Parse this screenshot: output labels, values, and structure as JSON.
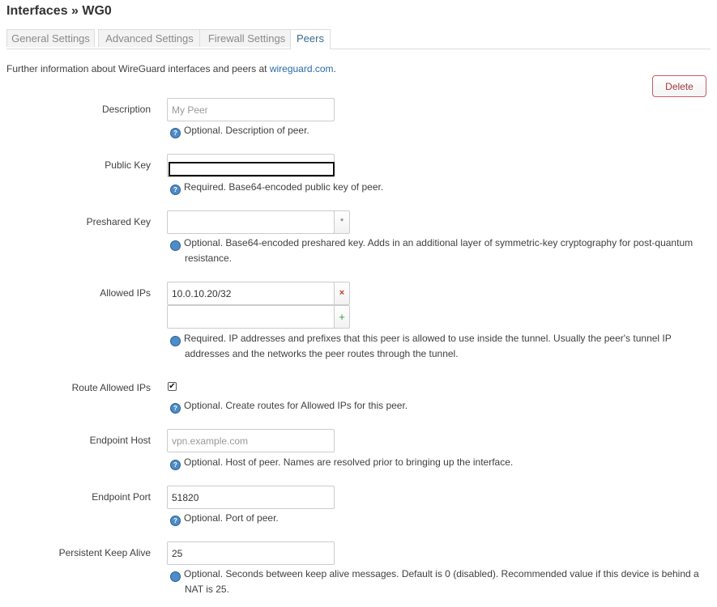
{
  "page_title": "Interfaces » WG0",
  "tabs": [
    {
      "label": "General Settings"
    },
    {
      "label": "Advanced Settings"
    },
    {
      "label": "Firewall Settings"
    },
    {
      "label": "Peers"
    }
  ],
  "intro": {
    "text": "Further information about WireGuard interfaces and peers at ",
    "link": "wireguard.com",
    "suffix": "."
  },
  "delete_label": "Delete",
  "fields": {
    "description": {
      "label": "Description",
      "value": "",
      "placeholder": "My Peer",
      "help": "Optional. Description of peer."
    },
    "public_key": {
      "label": "Public Key",
      "value": "",
      "help": "Required. Base64-encoded public key of peer."
    },
    "preshared_key": {
      "label": "Preshared Key",
      "value": "",
      "button": "*",
      "help": "Optional. Base64-encoded preshared key. Adds in an additional layer of symmetric-key cryptography for post-quantum resistance."
    },
    "allowed_ips": {
      "label": "Allowed IPs",
      "value": "10.0.10.20/32",
      "remove_symbol": "×",
      "new_value": "",
      "add_symbol": "+",
      "help": "Required. IP addresses and prefixes that this peer is allowed to use inside the tunnel. Usually the peer's tunnel IP addresses and the networks the peer routes through the tunnel."
    },
    "route_allowed_ips": {
      "label": "Route Allowed IPs",
      "checked_symbol": "✔",
      "help": "Optional. Create routes for Allowed IPs for this peer."
    },
    "endpoint_host": {
      "label": "Endpoint Host",
      "value": "",
      "placeholder": "vpn.example.com",
      "help": "Optional. Host of peer. Names are resolved prior to bringing up the interface."
    },
    "endpoint_port": {
      "label": "Endpoint Port",
      "value": "51820",
      "help": "Optional. Port of peer."
    },
    "persistent_keepalive": {
      "label": "Persistent Keep Alive",
      "value": "25",
      "help": "Optional. Seconds between keep alive messages. Default is 0 (disabled). Recommended value if this device is behind a NAT is 25."
    }
  },
  "help_icon": "help-icon",
  "colors": {
    "link": "#2a6aa8",
    "delete": "#a23a3e",
    "active_tab": "#3a6b8f"
  }
}
